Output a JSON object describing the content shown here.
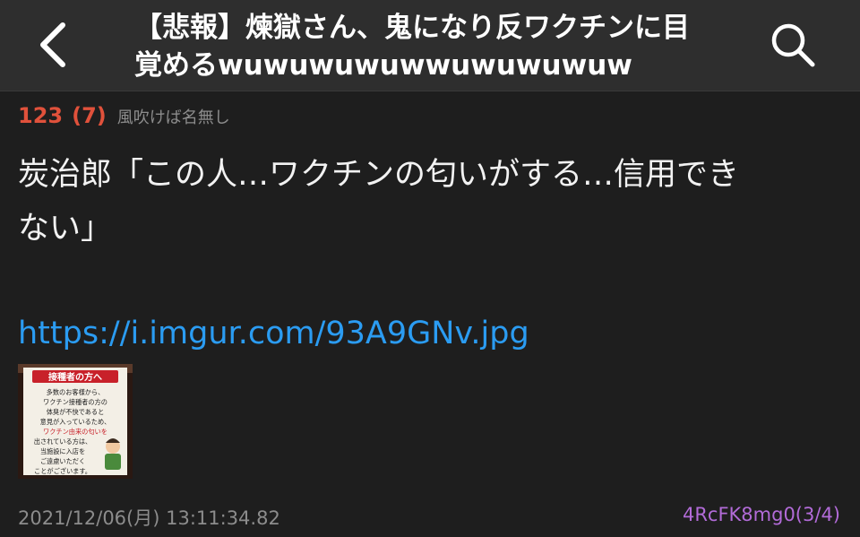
{
  "header": {
    "title_line1": "【悲報】煉獄さん、鬼になり反ワクチンに目",
    "title_line2": "覚めるwuwuwuwuwwuwuwuwuw",
    "back_icon": "chevron-left-icon",
    "search_icon": "search-icon"
  },
  "post": {
    "number": "123",
    "reply_count": "(7)",
    "name": "風吹けば名無し",
    "body_line1": "炭治郎「この人…ワクチンの匂いがする…信用でき",
    "body_line2": "ない」",
    "link": "https://i.imgur.com/93A9GNv.jpg",
    "thumbnail": {
      "heading": "接種者の方へ",
      "lines": [
        "多数のお客様から、",
        "ワクチン接種者の方の",
        "体臭が不快であると",
        "意見が入っているため、",
        "ワクチン由来の匂いを",
        "出されている方は、",
        "当施設に入店を",
        "ご遠慮いただく",
        "ことがございます。"
      ]
    },
    "timestamp": "2021/12/06(月) 13:11:34.82",
    "poster_id": "4RcFK8mg0(3/4)"
  },
  "colors": {
    "background": "#1e1e1e",
    "nav_background": "#2e2e2e",
    "post_number": "#e0513b",
    "link": "#2b9cf2",
    "poster_id": "#b26bd8",
    "muted": "#8c8c8c"
  }
}
